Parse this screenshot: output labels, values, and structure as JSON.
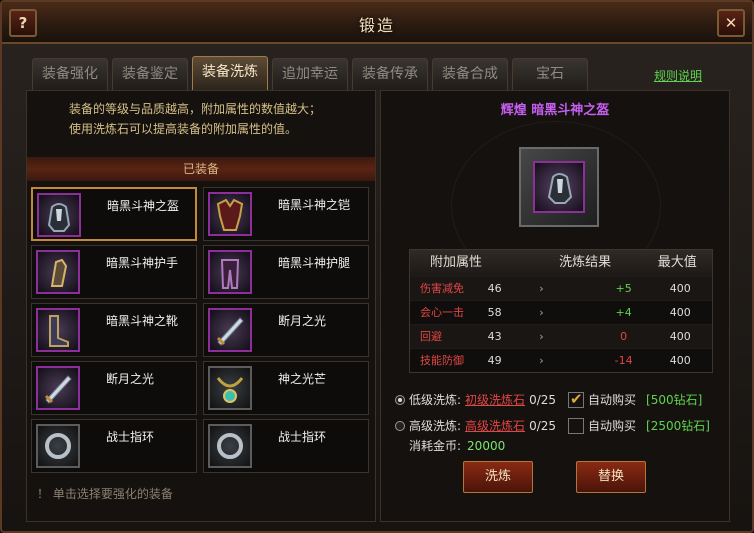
{
  "window": {
    "title": "锻造",
    "help_label": "?",
    "close_label": "✕"
  },
  "tabs": [
    {
      "label": "装备强化",
      "active": false
    },
    {
      "label": "装备鉴定",
      "active": false
    },
    {
      "label": "装备洗炼",
      "active": true
    },
    {
      "label": "追加幸运",
      "active": false
    },
    {
      "label": "装备传承",
      "active": false
    },
    {
      "label": "装备合成",
      "active": false
    },
    {
      "label": "宝石",
      "active": false
    }
  ],
  "rules_link": "规则说明",
  "left": {
    "desc_lines": [
      "装备的等级与品质越高，附加属性的数值越大；",
      "使用洗炼石可以提高装备的附加属性的值。"
    ],
    "equipped_label": "已装备",
    "items": [
      {
        "name": "暗黑斗神之盔",
        "icon": "helmet-icon",
        "selected": true,
        "quality": "purple"
      },
      {
        "name": "暗黑斗神之铠",
        "icon": "armor-icon",
        "selected": false,
        "quality": "purple"
      },
      {
        "name": "暗黑斗神护手",
        "icon": "gauntlet-icon",
        "selected": false,
        "quality": "purple"
      },
      {
        "name": "暗黑斗神护腿",
        "icon": "leggings-icon",
        "selected": false,
        "quality": "purple"
      },
      {
        "name": "暗黑斗神之靴",
        "icon": "boots-icon",
        "selected": false,
        "quality": "purple"
      },
      {
        "name": "断月之光",
        "icon": "sword-icon",
        "selected": false,
        "quality": "purple"
      },
      {
        "name": "断月之光",
        "icon": "sword-icon",
        "selected": false,
        "quality": "purple"
      },
      {
        "name": "神之光芒",
        "icon": "necklace-icon",
        "selected": false,
        "quality": "plain"
      },
      {
        "name": "战士指环",
        "icon": "ring-icon",
        "selected": false,
        "quality": "plain"
      },
      {
        "name": "战士指环",
        "icon": "ring-icon",
        "selected": false,
        "quality": "plain"
      }
    ],
    "hint": "！  单击选择要强化的装备"
  },
  "right": {
    "item_title": "辉煌  暗黑斗神之盔",
    "table": {
      "headers": [
        "附加属性",
        "洗炼结果",
        "最大值"
      ],
      "rows": [
        {
          "attr": "伤害减免",
          "value": "46",
          "arrow": "›",
          "result": "+5",
          "result_color": "#5fd34f",
          "max": "400"
        },
        {
          "attr": "会心一击",
          "value": "58",
          "arrow": "›",
          "result": "+4",
          "result_color": "#5fd34f",
          "max": "400"
        },
        {
          "attr": "回避",
          "value": "43",
          "arrow": "›",
          "result": "0",
          "result_color": "#e04646",
          "max": "400"
        },
        {
          "attr": "技能防御",
          "value": "49",
          "arrow": "›",
          "result": "-14",
          "result_color": "#e04646",
          "max": "400"
        }
      ]
    },
    "low": {
      "label": "低级洗炼:",
      "stone": "初级洗炼石",
      "count": "0/25",
      "auto_label": "自动购买",
      "gem_cost": "[500钻石]",
      "selected": true,
      "auto_checked": true
    },
    "high": {
      "label": "高级洗炼:",
      "stone": "高级洗炼石",
      "count": "0/25",
      "auto_label": "自动购买",
      "gem_cost": "[2500钻石]",
      "selected": false,
      "auto_checked": false
    },
    "gold_label": "消耗金币:",
    "gold_value": "20000",
    "refine_label": "洗炼",
    "replace_label": "替换"
  },
  "colors": {
    "purple_quality": "#8c2f9a",
    "accent_green": "#5fd34f",
    "accent_red": "#e04646",
    "title_purple": "#c45ff0"
  }
}
